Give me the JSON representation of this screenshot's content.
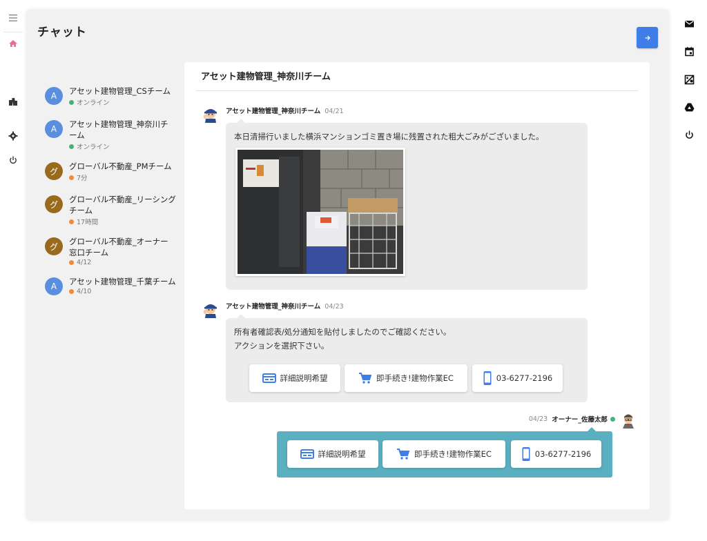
{
  "page": {
    "title": "チャット"
  },
  "colors": {
    "accent": "#3f7ee8",
    "online": "#4caf7a",
    "away": "#f08a3c",
    "own_bubble": "#5ab0c1",
    "avatar_blue": "#5a8fe0",
    "avatar_brown": "#9a6a1c"
  },
  "left_rail": {
    "icons": [
      "menu-icon",
      "home-icon",
      "buildings-icon",
      "gear-icon",
      "power-icon"
    ]
  },
  "right_rail": {
    "icons": [
      "mail-icon",
      "calendar-icon",
      "map-icon",
      "drive-icon",
      "power-icon"
    ]
  },
  "chat_list": [
    {
      "initial": "A",
      "name": "アセット建物管理_CSチーム",
      "status": "オンライン",
      "status_type": "online",
      "avatar_color": "#5a8fe0"
    },
    {
      "initial": "A",
      "name": "アセット建物管理_神奈川チーム",
      "status": "オンライン",
      "status_type": "online",
      "avatar_color": "#5a8fe0"
    },
    {
      "initial": "グ",
      "name": "グローバル不動産_PMチーム",
      "status": "7分",
      "status_type": "away",
      "avatar_color": "#9a6a1c"
    },
    {
      "initial": "グ",
      "name": "グローバル不動産_リーシングチーム",
      "status": "17時間",
      "status_type": "away",
      "avatar_color": "#9a6a1c"
    },
    {
      "initial": "グ",
      "name": "グローバル不動産_オーナー窓口チーム",
      "status": "4/12",
      "status_type": "away",
      "avatar_color": "#9a6a1c"
    },
    {
      "initial": "A",
      "name": "アセット建物管理_千葉チーム",
      "status": "4/10",
      "status_type": "away",
      "avatar_color": "#5a8fe0"
    }
  ],
  "chat": {
    "header": "アセット建物管理_神奈川チーム",
    "messages": [
      {
        "sender": "アセット建物管理_神奈川チーム",
        "date": "04/21",
        "text": "本日清掃行いました横浜マンションゴミ置き場に残置された粗大ごみがございました。"
      },
      {
        "sender": "アセット建物管理_神奈川チーム",
        "date": "04/23",
        "line1": "所有者確認表/処分通知を貼付しましたのでご確認ください。",
        "line2": "アクションを選択下さい。",
        "actions": {
          "detail": "詳細説明希望",
          "ec": "即手続き!建物作業EC",
          "phone": "03-6277-2196"
        }
      }
    ],
    "own": {
      "sender": "オーナー_佐藤太郎",
      "date": "04/23",
      "actions": {
        "detail": "詳細説明希望",
        "ec": "即手続き!建物作業EC",
        "phone": "03-6277-2196"
      }
    }
  }
}
